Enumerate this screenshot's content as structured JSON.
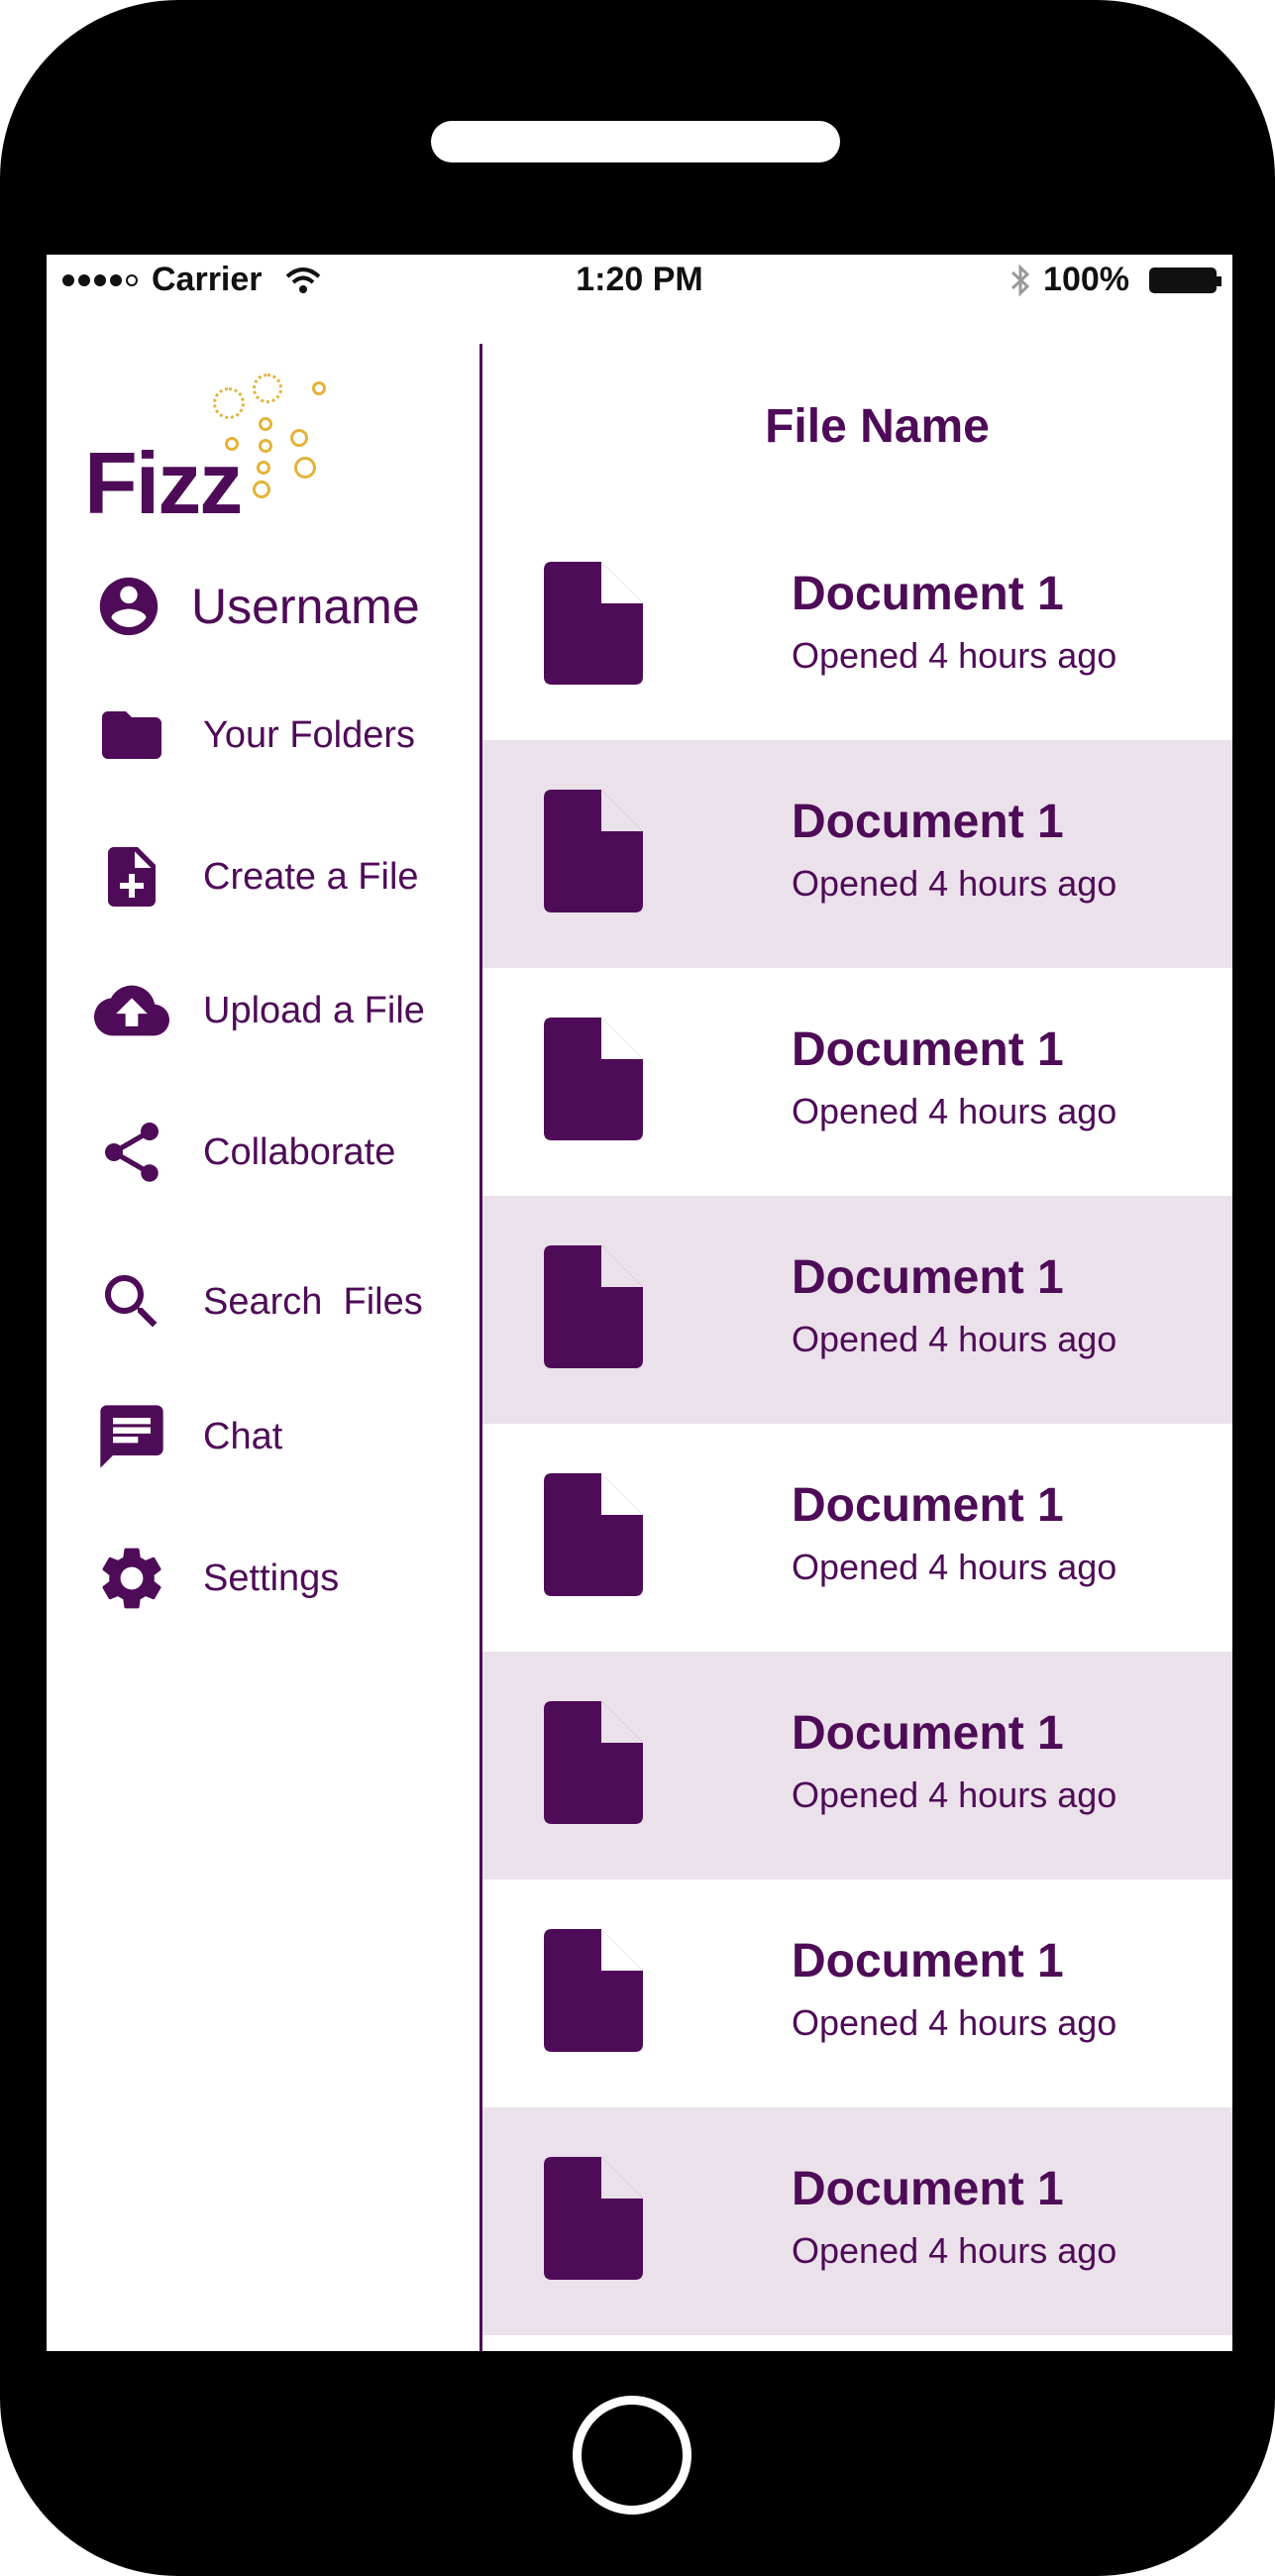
{
  "status_bar": {
    "carrier": "Carrier",
    "time": "1:20 PM",
    "battery": "100%"
  },
  "sidebar": {
    "logo": "Fizz",
    "username": "Username",
    "items": [
      {
        "label": "Your Folders",
        "icon": "folder-icon"
      },
      {
        "label": "Create a File",
        "icon": "file-add-icon"
      },
      {
        "label": "Upload a File",
        "icon": "cloud-upload-icon"
      },
      {
        "label": "Collaborate",
        "icon": "share-icon"
      },
      {
        "label": "Search  Files",
        "icon": "search-icon"
      },
      {
        "label": "Chat",
        "icon": "chat-icon"
      },
      {
        "label": "Settings",
        "icon": "gear-icon"
      }
    ]
  },
  "file_list": {
    "header": "File Name",
    "files": [
      {
        "name": "Document 1",
        "meta": "Opened 4 hours ago"
      },
      {
        "name": "Document 1",
        "meta": "Opened 4 hours ago"
      },
      {
        "name": "Document 1",
        "meta": "Opened 4 hours ago"
      },
      {
        "name": "Document 1",
        "meta": "Opened 4 hours ago"
      },
      {
        "name": "Document 1",
        "meta": "Opened 4 hours ago"
      },
      {
        "name": "Document 1",
        "meta": "Opened 4 hours ago"
      },
      {
        "name": "Document 1",
        "meta": "Opened 4 hours ago"
      },
      {
        "name": "Document 1",
        "meta": "Opened 4 hours ago"
      }
    ]
  },
  "colors": {
    "primary": "#4e0b57",
    "accent": "#e3b33a",
    "row_alt": "#ebe1ea"
  }
}
